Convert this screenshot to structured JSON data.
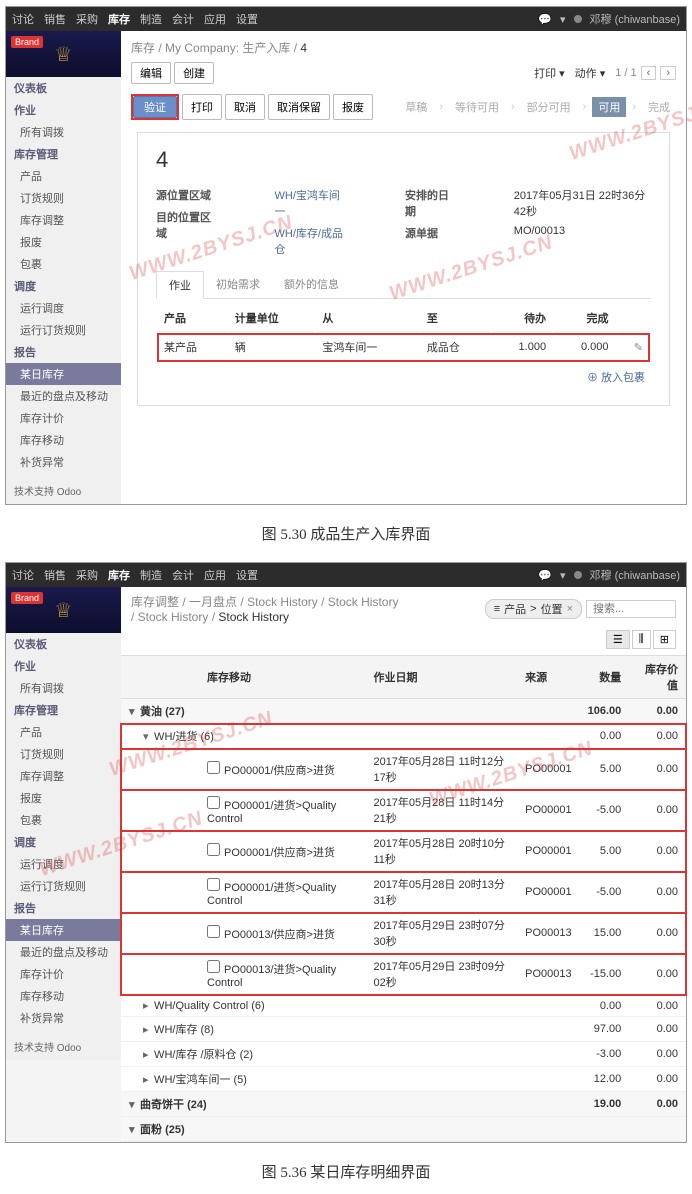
{
  "topnav": {
    "items": [
      "讨论",
      "销售",
      "采购",
      "库存",
      "制造",
      "会计",
      "应用",
      "设置"
    ],
    "active": 3,
    "user": "邓穆 (chiwanbase)"
  },
  "side": {
    "groups": [
      {
        "label": "仪表板"
      },
      {
        "label": "作业",
        "items": [
          "所有调拨"
        ]
      },
      {
        "label": "库存管理",
        "items": [
          "产品",
          "订货规则",
          "库存调整",
          "报废",
          "包裹"
        ]
      },
      {
        "label": "调度",
        "items": [
          "运行调度",
          "运行订货规则"
        ]
      },
      {
        "label": "报告",
        "items": [
          "某日库存",
          "最近的盘点及移动",
          "库存计价",
          "库存移动",
          "补货异常"
        ]
      }
    ],
    "footer": "技术支持 Odoo"
  },
  "shot1": {
    "crumbs": [
      "库存",
      "My Company: 生产入库",
      "4"
    ],
    "btns": {
      "edit": "编辑",
      "create": "创建",
      "print": "打印",
      "action": "动作"
    },
    "pager": "1 / 1",
    "toolbar": {
      "validate": "验证",
      "print": "打印",
      "cancel": "取消",
      "abandon": "取消保留",
      "scrap": "报废"
    },
    "status": [
      "草稿",
      "等待可用",
      "部分可用",
      "可用",
      "完成"
    ],
    "status_active": 3,
    "title": "4",
    "fields": {
      "src_lbl": "源位置区域",
      "src_val": "WH/宝鸿车间一",
      "dst_lbl": "目的位置区域",
      "dst_val": "WH/库存/成品仓",
      "date_lbl": "安排的日期",
      "date_val": "2017年05月31日 22时36分42秒",
      "srcdoc_lbl": "源单据",
      "srcdoc_val": "MO/00013"
    },
    "tabs": [
      "作业",
      "初始需求",
      "额外的信息"
    ],
    "cols": {
      "prod": "产品",
      "uom": "计量单位",
      "from": "从",
      "to": "至",
      "todo": "待办",
      "done": "完成"
    },
    "row": {
      "prod": "某产品",
      "uom": "辆",
      "from": "宝鸿车间一",
      "to": "成品仓",
      "todo": "1.000",
      "done": "0.000"
    },
    "addpkg": "放入包裹"
  },
  "caption1": "图 5.30  成品生产入库界面",
  "shot2": {
    "crumbs": [
      "库存调整",
      "一月盘点",
      "Stock History",
      "Stock History",
      "Stock History",
      "Stock History"
    ],
    "filter": {
      "tag1": "产品",
      "tag2": "位置",
      "placeholder": "搜索..."
    },
    "cols": {
      "move": "库存移动",
      "date": "作业日期",
      "src": "来源",
      "qty": "数量",
      "val": "库存价值"
    },
    "rows": [
      {
        "t": "g",
        "label": "黄油 (27)",
        "qty": "106.00",
        "val": "0.00"
      },
      {
        "t": "s",
        "label": "WH/进货 (6)",
        "qty": "0.00",
        "val": "0.00"
      },
      {
        "t": "p",
        "move": "PO00001/供应商>进货",
        "date": "2017年05月28日 11时12分17秒",
        "src": "PO00001",
        "qty": "5.00",
        "val": "0.00"
      },
      {
        "t": "p",
        "move": "PO00001/进货>Quality Control",
        "date": "2017年05月28日 11时14分21秒",
        "src": "PO00001",
        "qty": "-5.00",
        "val": "0.00"
      },
      {
        "t": "p",
        "move": "PO00001/供应商>进货",
        "date": "2017年05月28日 20时10分11秒",
        "src": "PO00001",
        "qty": "5.00",
        "val": "0.00"
      },
      {
        "t": "p",
        "move": "PO00001/进货>Quality Control",
        "date": "2017年05月28日 20时13分31秒",
        "src": "PO00001",
        "qty": "-5.00",
        "val": "0.00"
      },
      {
        "t": "p",
        "move": "PO00013/供应商>进货",
        "date": "2017年05月29日 23时07分30秒",
        "src": "PO00013",
        "qty": "15.00",
        "val": "0.00"
      },
      {
        "t": "p",
        "move": "PO00013/进货>Quality Control",
        "date": "2017年05月29日 23时09分02秒",
        "src": "PO00013",
        "qty": "-15.00",
        "val": "0.00"
      },
      {
        "t": "s2",
        "label": "WH/Quality Control (6)",
        "qty": "0.00",
        "val": "0.00"
      },
      {
        "t": "s2",
        "label": "WH/库存 (8)",
        "qty": "97.00",
        "val": "0.00"
      },
      {
        "t": "s2",
        "label": "WH/库存 /原料仓 (2)",
        "qty": "-3.00",
        "val": "0.00"
      },
      {
        "t": "s2",
        "label": "WH/宝鸿车间一 (5)",
        "qty": "12.00",
        "val": "0.00"
      },
      {
        "t": "g",
        "label": "曲奇饼干 (24)",
        "qty": "19.00",
        "val": "0.00"
      },
      {
        "t": "g",
        "label": "面粉 (25)",
        "qty": "",
        "val": ""
      }
    ]
  },
  "caption2": "图 5.36  某日库存明细界面",
  "watermark": "WWW.2BYSJ.CN"
}
